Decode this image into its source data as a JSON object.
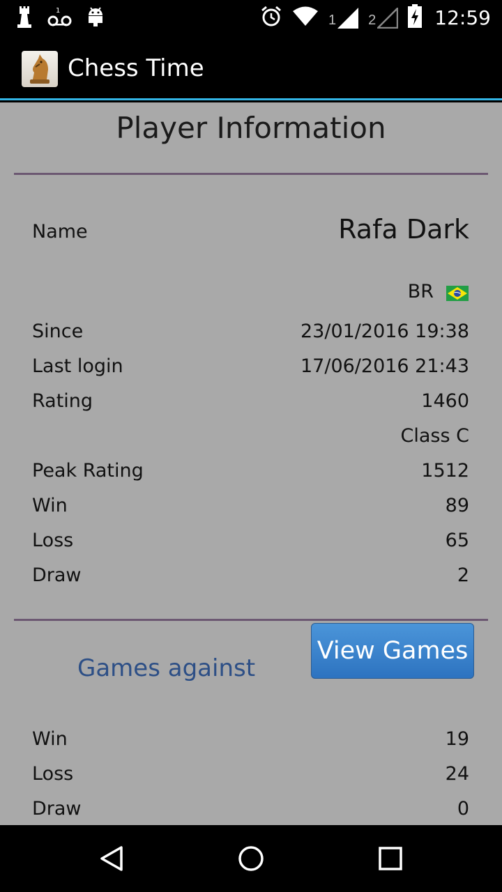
{
  "status_bar": {
    "left_icons": [
      "chess-notification-icon",
      "voicemail-icon",
      "android-icon"
    ],
    "right_icons": [
      "alarm-icon",
      "wifi-icon",
      "signal-sim1-icon",
      "signal-sim2-icon",
      "battery-charging-icon"
    ],
    "sim1_label": "1",
    "sim2_label": "2",
    "time": "12:59"
  },
  "app_bar": {
    "title": "Chess Time",
    "icon": "chess-knight-icon"
  },
  "page": {
    "title": "Player Information",
    "profile": {
      "name_label": "Name",
      "name_value": "Rafa Dark",
      "country_code": "BR",
      "country_flag": "brazil-flag-icon",
      "rows": [
        {
          "label": "Since",
          "value": "23/01/2016 19:38"
        },
        {
          "label": "Last login",
          "value": "17/06/2016 21:43"
        },
        {
          "label": "Rating",
          "value": "1460"
        },
        {
          "label": "",
          "value": "Class C"
        },
        {
          "label": "Peak Rating",
          "value": "1512"
        },
        {
          "label": "Win",
          "value": "89"
        },
        {
          "label": "Loss",
          "value": "65"
        },
        {
          "label": "Draw",
          "value": "2"
        }
      ]
    },
    "games_against": {
      "title": "Games against",
      "view_games_label": "View Games",
      "rows": [
        {
          "label": "Win",
          "value": "19"
        },
        {
          "label": "Loss",
          "value": "24"
        },
        {
          "label": "Draw",
          "value": "0"
        }
      ]
    }
  },
  "nav_bar": {
    "buttons": [
      "back-icon",
      "home-icon",
      "recents-icon"
    ]
  },
  "colors": {
    "content_background": "#a9a9a9",
    "divider": "#6c5872",
    "accent_line": "#33b5e5",
    "button_blue": "#3b84cc",
    "games_against_text": "#2d4f86"
  }
}
